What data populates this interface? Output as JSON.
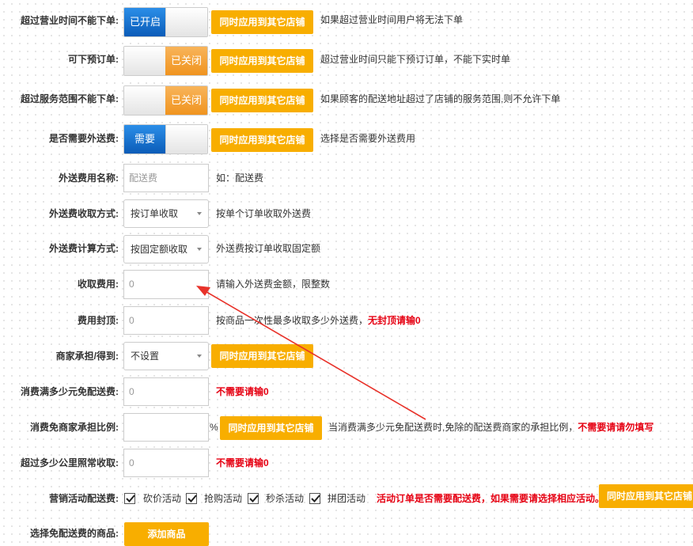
{
  "rows": {
    "overtime": {
      "label": "超过营业时间不能下单:",
      "state": "已开启",
      "apply": "同时应用到其它店铺",
      "desc": "如果超过营业时间用户将无法下单"
    },
    "preorder": {
      "label": "可下预订单:",
      "state": "已关闭",
      "apply": "同时应用到其它店铺",
      "desc": "超过营业时间只能下预订订单，不能下实时单"
    },
    "outofrange": {
      "label": "超过服务范围不能下单:",
      "state": "已关闭",
      "apply": "同时应用到其它店铺",
      "desc": "如果顾客的配送地址超过了店铺的服务范围,则不允许下单"
    },
    "needfee": {
      "label": "是否需要外送费:",
      "state": "需要",
      "apply": "同时应用到其它店铺",
      "desc": "选择是否需要外送费用"
    },
    "feename": {
      "label": "外送费用名称:",
      "placeholder": "配送费",
      "desc": "如：配送费"
    },
    "feemode": {
      "label": "外送费收取方式:",
      "selected": "按订单收取",
      "desc": "按单个订单收取外送费"
    },
    "feecalc": {
      "label": "外送费计算方式:",
      "selected": "按固定额收取",
      "desc": "外送费按订单收取固定额"
    },
    "feeamount": {
      "label": "收取费用:",
      "value": "0",
      "desc": "请输入外送费金额，限整数"
    },
    "feecap": {
      "label": "费用封顶:",
      "value": "0",
      "desc": "按商品一次性最多收取多少外送费，",
      "desc_red": "无封顶请输0"
    },
    "merchant": {
      "label": "商家承担/得到:",
      "selected": "不设置",
      "apply": "同时应用到其它店铺"
    },
    "freeover": {
      "label": "消费满多少元免配送费:",
      "value": "0",
      "desc_red": "不需要请输0"
    },
    "freeratio": {
      "label": "消费免商家承担比例:",
      "value": "",
      "unit": "%",
      "apply": "同时应用到其它店铺",
      "desc": "当消费满多少元免配送费时,免除的配送费商家的承担比例，",
      "desc_red": "不需要请请勿填写"
    },
    "overkm": {
      "label": "超过多少公里照常收取:",
      "value": "0",
      "desc_red": "不需要请输0"
    },
    "promo": {
      "label": "营销活动配送费:",
      "items": [
        "砍价活动",
        "抢购活动",
        "秒杀活动",
        "拼团活动"
      ],
      "desc_red": "活动订单是否需要配送费，如果需要请选择相应活动。",
      "apply": "同时应用到其它店铺"
    },
    "choose": {
      "label": "选择免配送费的商品:",
      "button": "添加商品"
    }
  },
  "colors": {
    "accent": "#f8ae00",
    "on": "#0b5cb8",
    "off": "#f0941f",
    "annotation": "#e8322a",
    "warning": "#e60012"
  }
}
